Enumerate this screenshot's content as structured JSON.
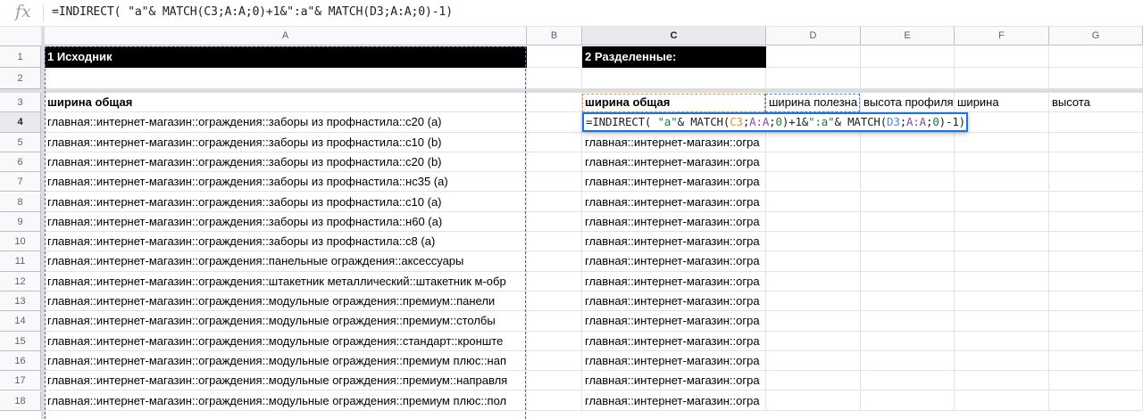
{
  "formula_bar": {
    "fx_label": "fx",
    "formula": "=INDIRECT( \"a\"& MATCH(C3;A:A;0)+1&\":a\"& MATCH(D3;A:A;0)-1)"
  },
  "columns": [
    "A",
    "B",
    "C",
    "D",
    "E",
    "F",
    "G"
  ],
  "rows": [
    "1",
    "2",
    "3",
    "4",
    "5",
    "6",
    "7",
    "8",
    "9",
    "10",
    "11",
    "12",
    "13",
    "14",
    "15",
    "16",
    "17",
    "18"
  ],
  "cells": {
    "A1": "1 Исходник",
    "C1": "2 Разделенные:",
    "A3": "ширина общая",
    "C3": "ширина общая",
    "D3": "ширина полезна",
    "E3": "высота профиля",
    "F3": "ширина",
    "G3": "высота",
    "A4": "главная::интернет-магазин::ограждения::заборы из профнастила::с20 (а)",
    "A5": "главная::интернет-магазин::ограждения::заборы из профнастила::с10 (b)",
    "A6": "главная::интернет-магазин::ограждения::заборы из профнастила::с20 (b)",
    "A7": "главная::интернет-магазин::ограждения::заборы из профнастила::нс35 (а)",
    "A8": "главная::интернет-магазин::ограждения::заборы из профнастила::с10 (а)",
    "A9": "главная::интернет-магазин::ограждения::заборы из профнастила::н60 (а)",
    "A10": "главная::интернет-магазин::ограждения::заборы из профнастила::с8 (а)",
    "A11": "главная::интернет-магазин::ограждения::панельные ограждения::аксессуары",
    "A12": "главная::интернет-магазин::ограждения::штакетник металлический::штакетник м-обр",
    "A13": "главная::интернет-магазин::ограждения::модульные ограждения::премиум::панели",
    "A14": "главная::интернет-магазин::ограждения::модульные ограждения::премиум::столбы",
    "A15": "главная::интернет-магазин::ограждения::модульные ограждения::стандарт::кронште",
    "A16": "главная::интернет-магазин::ограждения::модульные ограждения::премиум плюс::нап",
    "A17": "главная::интернет-магазин::ограждения::модульные ограждения::премиум::направля",
    "A18": "главная::интернет-магазин::ограждения::модульные ограждения::премиум плюс::пол",
    "C5": "главная::интернет-магазин::огра",
    "C6": "главная::интернет-магазин::огра",
    "C7": "главная::интернет-магазин::огра",
    "C8": "главная::интернет-магазин::огра",
    "C9": "главная::интернет-магазин::огра",
    "C10": "главная::интернет-магазин::огра",
    "C11": "главная::интернет-магазин::огра",
    "C12": "главная::интернет-магазин::огра",
    "C13": "главная::интернет-магазин::огра",
    "C14": "главная::интернет-магазин::огра",
    "C15": "главная::интернет-магазин::огра",
    "C16": "главная::интернет-магазин::огра",
    "C17": "главная::интернет-магазин::огра",
    "C18": "главная::интернет-магазин::огра"
  },
  "editor": {
    "p1": "=INDIRECT( ",
    "p2": "\"a\"",
    "p3": "& MATCH(",
    "p4": "C3",
    "p5": ";",
    "p6": "A:A",
    "p7": ";",
    "p8": "0",
    "p9": ")+1&",
    "p10": "\":a\"",
    "p11": "& MATCH(",
    "p12": "D3",
    "p13": ";",
    "p14": "A:A",
    "p15": ";",
    "p16": "0",
    "p17": ")-1)"
  },
  "colors": {
    "ref_c3": "#e69138",
    "ref_d3": "#4a86e8",
    "ref_range": "#8e44ad",
    "selection": "#1a73e8"
  }
}
